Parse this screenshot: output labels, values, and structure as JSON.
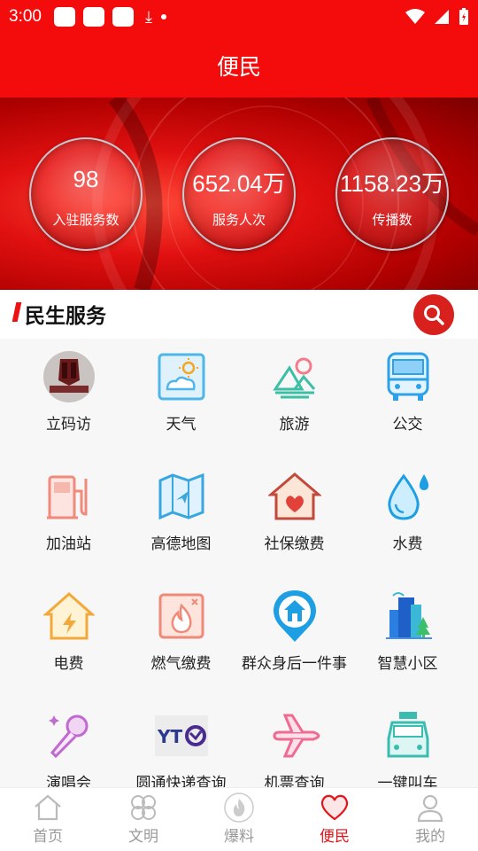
{
  "status": {
    "time": "3:00"
  },
  "header": {
    "title": "便民"
  },
  "stats": [
    {
      "value": "98",
      "label": "入驻服务数"
    },
    {
      "value": "652.04万",
      "label": "服务人次"
    },
    {
      "value": "1158.23万",
      "label": "传播数"
    }
  ],
  "section": {
    "title": "民生服务"
  },
  "services": [
    {
      "label": "立码访",
      "icon": "renshou-xinfang-logo-icon"
    },
    {
      "label": "天气",
      "icon": "weather-icon"
    },
    {
      "label": "旅游",
      "icon": "travel-icon"
    },
    {
      "label": "公交",
      "icon": "bus-icon"
    },
    {
      "label": "加油站",
      "icon": "gas-station-icon"
    },
    {
      "label": "高德地图",
      "icon": "map-icon"
    },
    {
      "label": "社保缴费",
      "icon": "house-heart-icon"
    },
    {
      "label": "水费",
      "icon": "water-drop-icon"
    },
    {
      "label": "电费",
      "icon": "electricity-icon"
    },
    {
      "label": "燃气缴费",
      "icon": "gas-flame-icon"
    },
    {
      "label": "群众身后一件事",
      "icon": "location-house-icon"
    },
    {
      "label": "智慧小区",
      "icon": "buildings-icon"
    },
    {
      "label": "演唱会",
      "icon": "microphone-icon"
    },
    {
      "label": "圆通快递查询",
      "icon": "yto-logo-icon"
    },
    {
      "label": "机票查询",
      "icon": "airplane-icon"
    },
    {
      "label": "一键叫车",
      "icon": "taxi-icon"
    }
  ],
  "tabs": [
    {
      "label": "首页",
      "icon": "home-icon",
      "active": false
    },
    {
      "label": "文明",
      "icon": "clover-icon",
      "active": false
    },
    {
      "label": "爆料",
      "icon": "fire-icon",
      "active": false
    },
    {
      "label": "便民",
      "icon": "heart-icon",
      "active": true
    },
    {
      "label": "我的",
      "icon": "user-icon",
      "active": false
    }
  ],
  "colors": {
    "primary": "#f40c0c",
    "active_tab": "#e4161b"
  }
}
